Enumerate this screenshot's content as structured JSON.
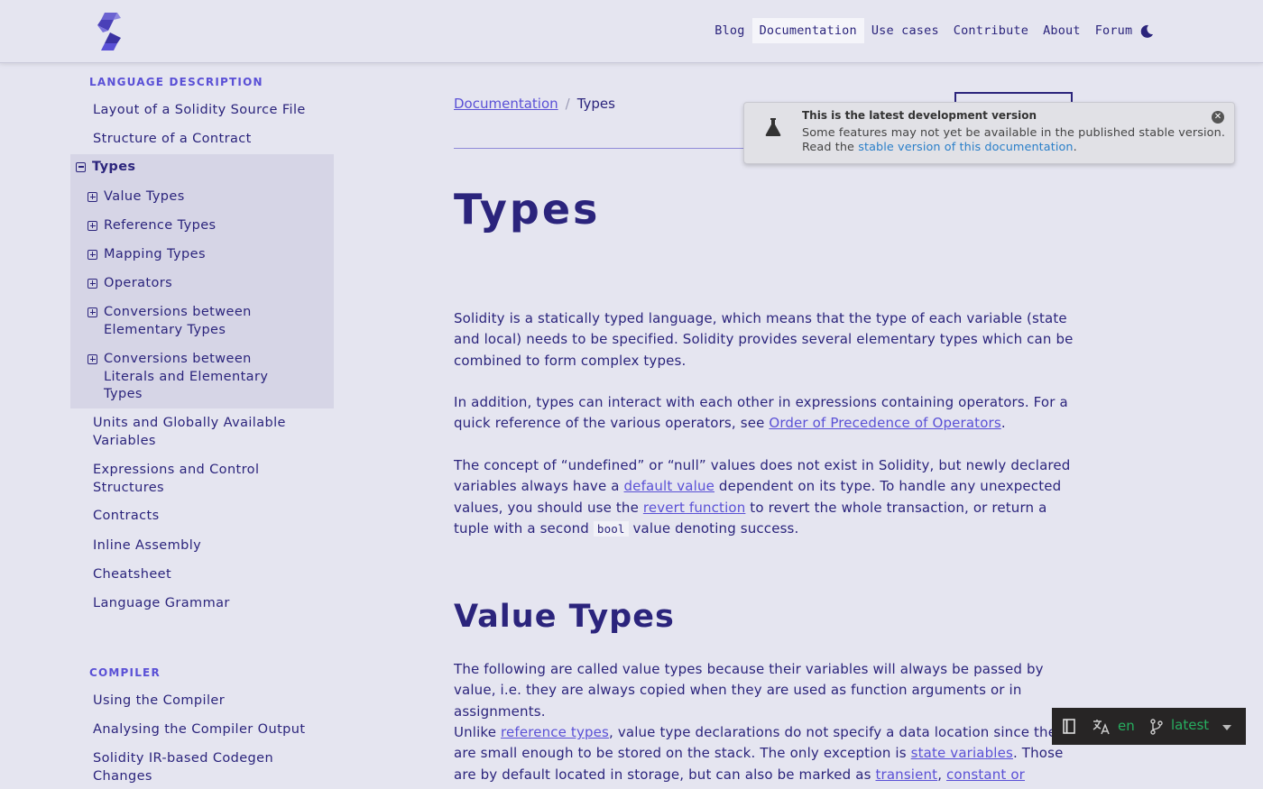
{
  "header": {
    "nav": [
      {
        "label": "Blog",
        "active": false
      },
      {
        "label": "Documentation",
        "active": true
      },
      {
        "label": "Use cases",
        "active": false
      },
      {
        "label": "Contribute",
        "active": false
      },
      {
        "label": "About",
        "active": false
      },
      {
        "label": "Forum ↗",
        "active": false
      }
    ],
    "theme_icon": "moon-icon",
    "logo_icon": "solidity-logo"
  },
  "sidebar": {
    "section1_title": "LANGUAGE DESCRIPTION",
    "links_top": [
      "Layout of a Solidity Source File",
      "Structure of a Contract"
    ],
    "current": "Types",
    "current_children": [
      "Value Types",
      "Reference Types",
      "Mapping Types",
      "Operators",
      "Conversions between Elementary Types",
      "Conversions between Literals and Elementary Types"
    ],
    "links_bottom": [
      "Units and Globally Available Variables",
      "Expressions and Control Structures",
      "Contracts",
      "Inline Assembly",
      "Cheatsheet",
      "Language Grammar"
    ],
    "section2_title": "COMPILER",
    "compiler_links": [
      "Using the Compiler",
      "Analysing the Compiler Output",
      "Solidity IR-based Codegen Changes"
    ]
  },
  "breadcrumb": {
    "parent": "Documentation",
    "separator": "/",
    "current": "Types"
  },
  "banner": {
    "title": "This is the latest development version",
    "line1": "Some features may not yet be available in the published stable version.",
    "line2_prefix": "Read the ",
    "line2_link": "stable version of this documentation",
    "line2_suffix": "."
  },
  "content": {
    "title": "Types",
    "p1": "Solidity is a statically typed language, which means that the type of each variable (state and local) needs to be specified. Solidity provides several elementary types which can be combined to form complex types.",
    "p2_text": "In addition, types can interact with each other in expressions containing operators. For a quick reference of the various operators, see ",
    "p2_link": "Order of Precedence of Operators",
    "p2_end": ".",
    "p3_a": "The concept of “undefined” or “null” values does not exist in Solidity, but newly declared variables always have a ",
    "p3_link1": "default value",
    "p3_b": " dependent on its type. To handle any unexpected values, you should use the ",
    "p3_link2": "revert function",
    "p3_c": " to revert the whole transaction, or return a tuple with a second ",
    "p3_code": "bool",
    "p3_d": " value denoting success.",
    "h2": "Value Types",
    "p4": "The following are called value types because their variables will always be passed by value, i.e. they are always copied when they are used as function arguments or in assignments.",
    "p5_a": "Unlike ",
    "p5_link1": "reference types",
    "p5_b": ", value type declarations do not specify a data location since they are small enough to be stored on the stack. The only exception is ",
    "p5_link2": "state variables",
    "p5_c": ". Those are by default located in storage, but can also be marked as ",
    "p5_link3": "transient",
    "p5_d": ", ",
    "p5_link4": "constant or immutable",
    "p5_e": "."
  },
  "flyout": {
    "lang": "en",
    "version": "latest"
  }
}
